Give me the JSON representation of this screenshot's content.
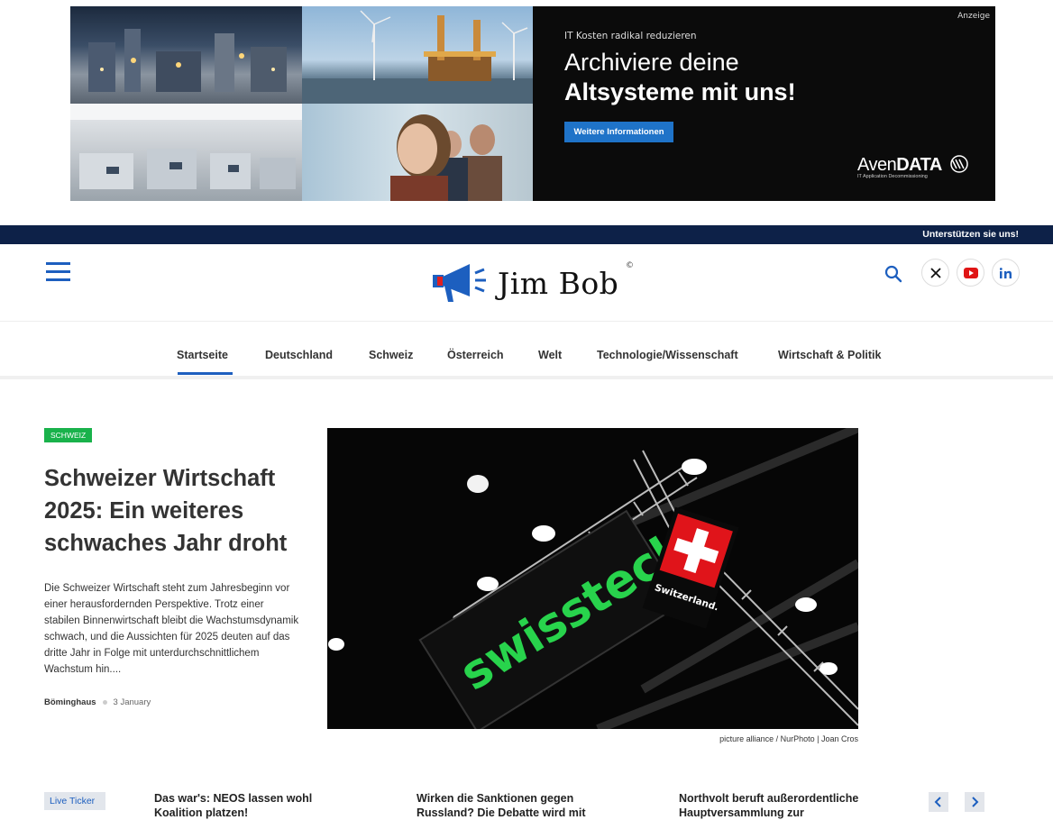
{
  "ad": {
    "label": "Anzeige",
    "kicker": "IT Kosten radikal reduzieren",
    "headline_light": "Archiviere deine",
    "headline_bold": "Altsysteme mit uns!",
    "button": "Weitere Informationen",
    "brand_light": "Aven",
    "brand_bold": "DATA",
    "brand_tagline": "IT Application Decommissioning"
  },
  "topbar": {
    "support_link": "Unterstützen sie uns!"
  },
  "header": {
    "logo_text": "Jim Bob",
    "logo_reg": "©",
    "icons": [
      "menu-icon",
      "search-icon",
      "x-icon",
      "youtube-icon",
      "linkedin-icon"
    ]
  },
  "nav": {
    "items": [
      "Startseite",
      "Deutschland",
      "Schweiz",
      "Österreich",
      "Welt",
      "Technologie/Wissenschaft",
      "Wirtschaft & Politik"
    ],
    "active": "Startseite"
  },
  "article": {
    "category": "Schweiz",
    "title": "Schweizer Wirtschaft 2025: Ein weiteres schwaches Jahr droht",
    "teaser": "Die Schweizer Wirtschaft steht zum Jahresbeginn vor einer herausfordernden Perspektive. Trotz einer stabilen Binnenwirtschaft bleibt die Wachstumsdynamik schwach, und die Aussichten für 2025 deuten auf das dritte Jahr in Folge mit unterdurchschnittlichem Wachstum hin....",
    "author": "Böminghaus",
    "date": "3 January",
    "image_sign_text": "swisstech.",
    "image_flag_text": "Switzerland.",
    "image_credit": "picture alliance / NurPhoto | Joan Cros"
  },
  "ticker": {
    "label": "Live Ticker",
    "items": [
      "Das war's: NEOS lassen wohl Koalition platzen!",
      "Wirken die Sanktionen gegen Russland? Die Debatte wird mit",
      "Northvolt beruft außerordentliche Hauptversammlung zur"
    ]
  },
  "colors": {
    "brand_blue": "#1d5fbf",
    "topbar_navy": "#0d2148",
    "category_green": "#19b24b",
    "ad_button_blue": "#1f73c8"
  }
}
